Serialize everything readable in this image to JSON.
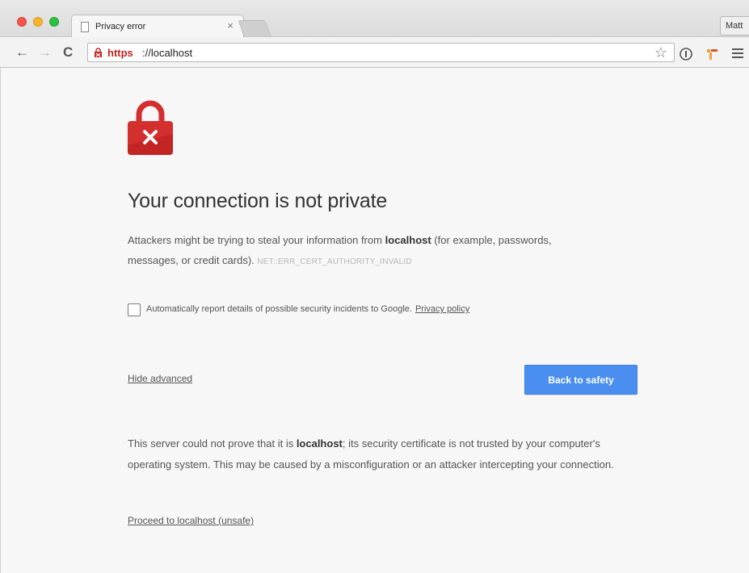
{
  "browser": {
    "tab_title": "Privacy error",
    "tab_close": "×",
    "profile_name": "Matt",
    "url_scheme": "https",
    "url_rest": "://localhost"
  },
  "toolbar_icons": {
    "back": "arrow-left-icon",
    "forward": "arrow-right-icon",
    "reload": "reload-icon",
    "bookmark": "star-icon",
    "menu": "hamburger-menu-icon"
  },
  "page": {
    "heading": "Your connection is not private",
    "explanation_prefix": "Attackers might be trying to steal your information from ",
    "host": "localhost",
    "explanation_suffix": " (for example, passwords, messages, or credit cards). ",
    "error_code": "NET::ERR_CERT_AUTHORITY_INVALID",
    "report_checkbox_label": "Automatically report details of possible security incidents to Google.",
    "privacy_policy_link": "Privacy policy",
    "report_checked": false,
    "hide_advanced_link": "Hide advanced",
    "back_button": "Back to safety",
    "details_prefix": "This server could not prove that it is ",
    "details_suffix": "; its security certificate is not trusted by your computer's operating system. This may be caused by a misconfiguration or an attacker intercepting your connection.",
    "proceed_link": "Proceed to localhost (unsafe)"
  },
  "colors": {
    "accent_blue": "#4a8ef0",
    "error_red": "#d32f2f"
  }
}
